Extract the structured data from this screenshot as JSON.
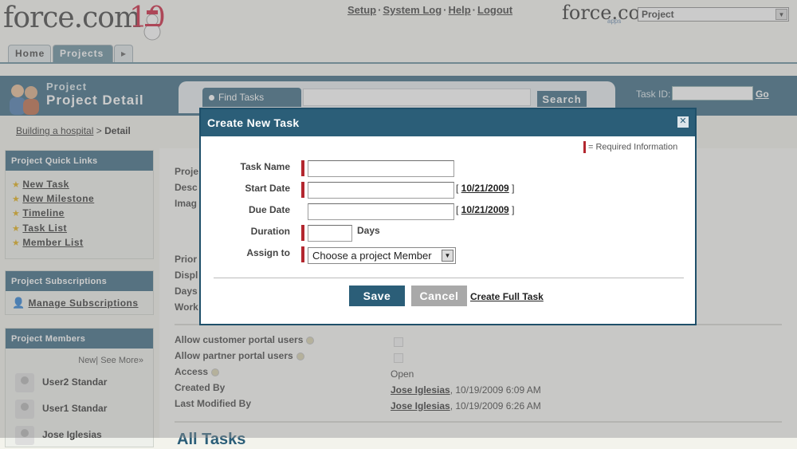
{
  "header": {
    "logo": "force.com",
    "logo_suffix": "10",
    "links": [
      "Setup",
      "System Log",
      "Help",
      "Logout"
    ],
    "app_logo": "force.com",
    "app_logo_sub": "apps",
    "app_select": "Project"
  },
  "tabs": [
    {
      "label": "Home"
    },
    {
      "label": "Projects"
    }
  ],
  "band": {
    "subtitle": "Project",
    "title": "Project Detail",
    "find_tasks": "Find Tasks",
    "search_button": "Search",
    "task_id_label": "Task ID:",
    "go_label": "Go"
  },
  "breadcrumb": {
    "link": "Building a hospital",
    "sep": ">",
    "current": "Detail"
  },
  "sidebar": {
    "quick_links_title": "Project Quick Links",
    "quick_links": [
      "New Task",
      "New Milestone",
      "Timeline",
      "Task List",
      "Member List"
    ],
    "subscriptions_title": "Project Subscriptions",
    "manage_subscriptions": "Manage Subscriptions",
    "members_title": "Project Members",
    "members_new": "New",
    "members_see_more": "See More»",
    "members": [
      "User2 Standar",
      "User1 Standar",
      "Jose Iglesias"
    ]
  },
  "detail": {
    "partial_labels": [
      "Proje",
      "Desc",
      "Imag",
      "Prior",
      "Displ",
      "Days",
      "Work"
    ],
    "fields": [
      {
        "label": "Allow customer portal users",
        "value": ""
      },
      {
        "label": "Allow partner portal users",
        "value": ""
      },
      {
        "label": "Access",
        "value": "Open"
      },
      {
        "label": "Created By",
        "user": "Jose Iglesias",
        "value": ", 10/19/2009 6:09 AM"
      },
      {
        "label": "Last Modified By",
        "user": "Jose Iglesias",
        "value": ", 10/19/2009 6:26 AM"
      }
    ],
    "all_tasks": "All Tasks"
  },
  "modal": {
    "title": "Create New Task",
    "required_legend": "= Required Information",
    "task_name_label": "Task Name",
    "start_date_label": "Start Date",
    "start_date_link": "10/21/2009",
    "due_date_label": "Due Date",
    "due_date_link": "10/21/2009",
    "duration_label": "Duration",
    "duration_unit": "Days",
    "assign_label": "Assign to",
    "assign_value": "Choose a project Member",
    "save": "Save",
    "cancel": "Cancel",
    "full_task": "Create Full Task"
  },
  "colors": {
    "brand": "#2b5e78",
    "required": "#b3272f",
    "cancel": "#a9a9a9"
  }
}
